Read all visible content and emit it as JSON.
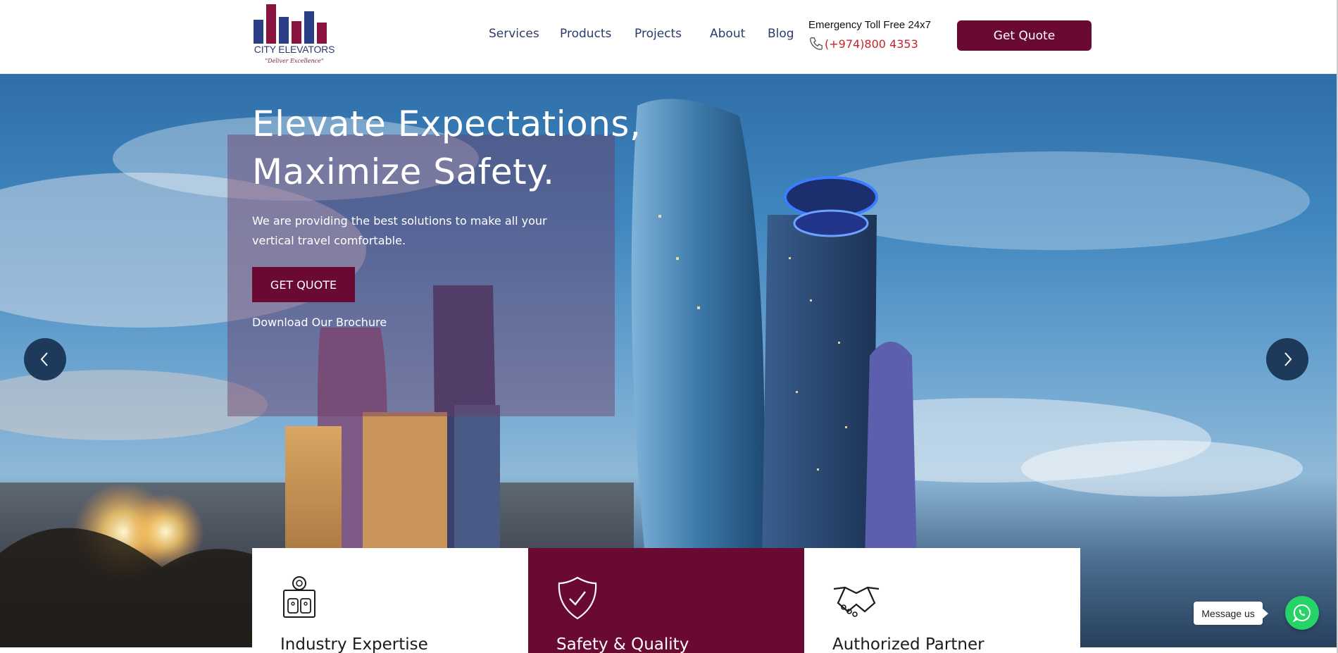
{
  "header": {
    "logo": {
      "name": "CITY ELEVATORS",
      "tagline": "\"Deliver Excellence\""
    },
    "nav": [
      "Services",
      "Products",
      "Projects",
      "About",
      "Blog"
    ],
    "emergency": {
      "label": "Emergency Toll Free 24x7",
      "phone": "(+974)800 4353",
      "icon": "phone-icon"
    },
    "cta_label": "Get Quote"
  },
  "hero": {
    "title_line1": "Elevate Expectations,",
    "title_line2": "Maximize Safety.",
    "subtitle_line1": "We are providing the best solutions to make all your",
    "subtitle_line2": "vertical travel comfortable.",
    "button_label": "GET QUOTE",
    "brochure_link": "Download Our Brochure",
    "prev_icon": "chevron-left-icon",
    "next_icon": "chevron-right-icon"
  },
  "features": [
    {
      "title": "Industry Expertise",
      "icon": "elevator-panel-icon",
      "active": false
    },
    {
      "title": "Safety & Quality",
      "icon": "shield-check-icon",
      "active": true
    },
    {
      "title": "Authorized Partner",
      "icon": "handshake-icon",
      "active": false
    }
  ],
  "whatsapp": {
    "label": "Message us",
    "icon": "whatsapp-icon"
  },
  "colors": {
    "brand": "#6a0a33",
    "navy": "#2e3a6b",
    "phone_red": "#c8232c",
    "whatsapp": "#25d366"
  }
}
